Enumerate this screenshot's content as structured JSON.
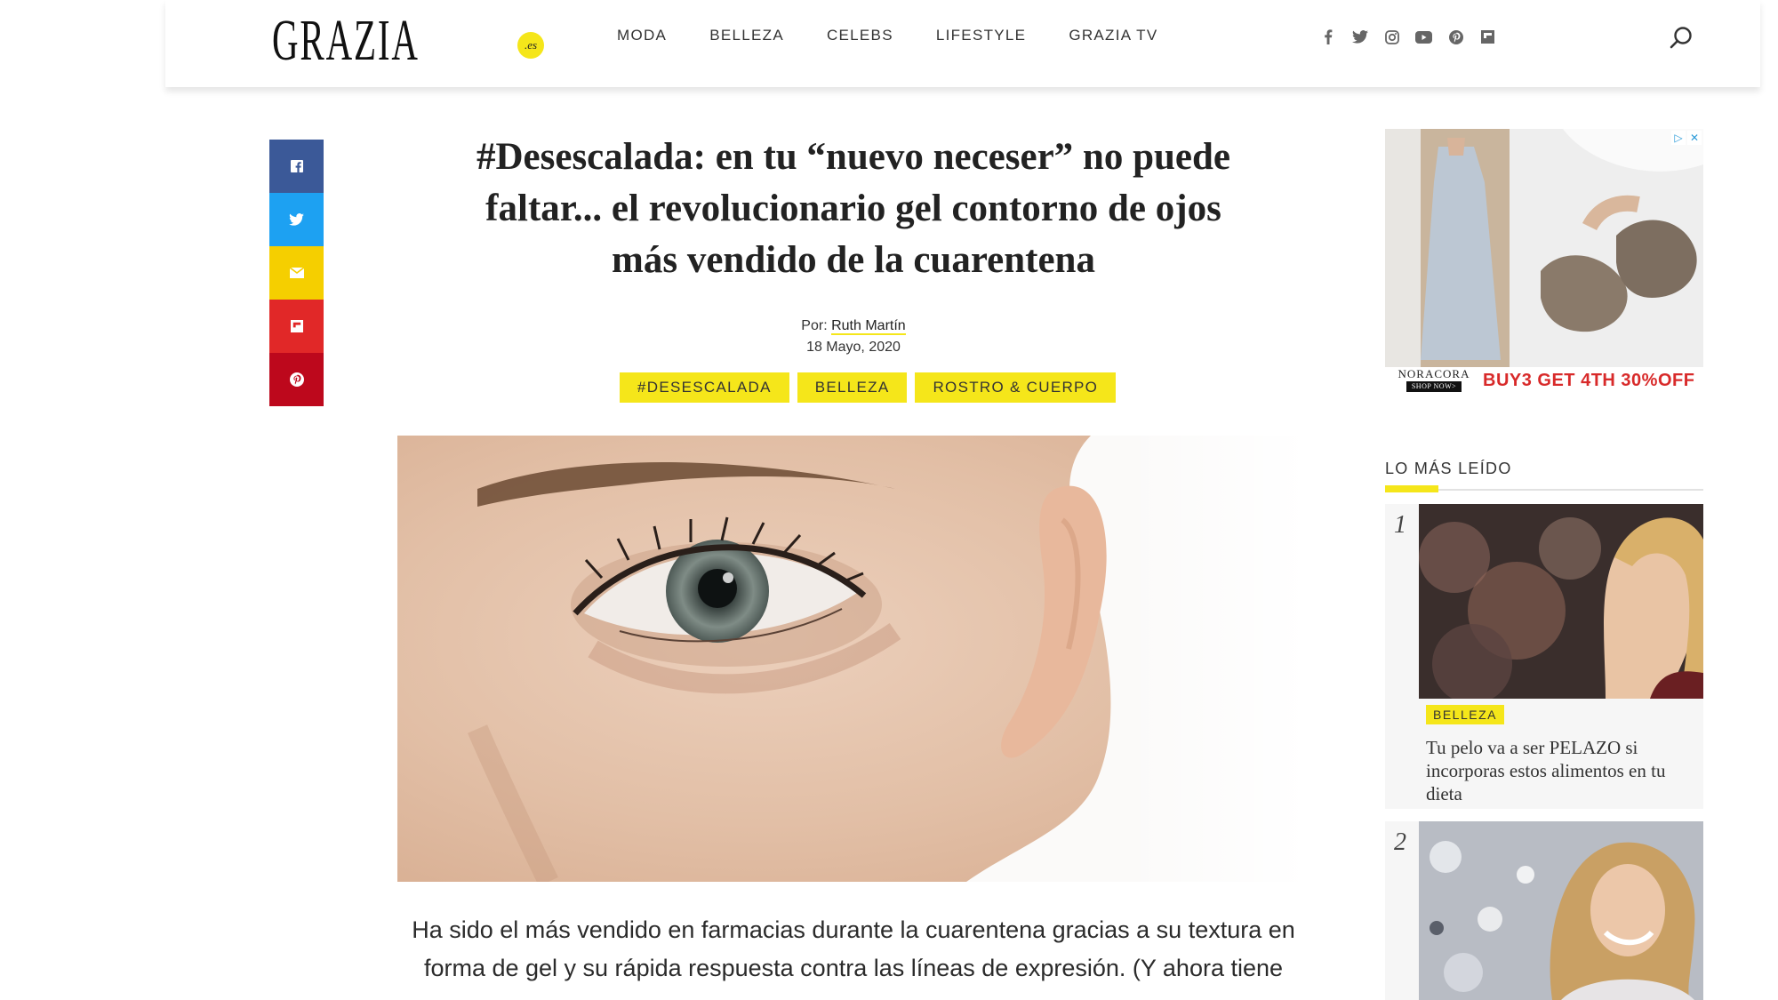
{
  "brand": {
    "logo": "GRAZIA",
    "logo_suffix": ".es",
    "accent_color": "#f5e61a"
  },
  "nav": {
    "items": [
      "MODA",
      "BELLEZA",
      "CELEBS",
      "LIFESTYLE",
      "GRAZIA TV"
    ]
  },
  "social_icons": [
    "facebook-icon",
    "twitter-icon",
    "instagram-icon",
    "youtube-icon",
    "pinterest-icon",
    "flipboard-icon"
  ],
  "share_bar": [
    {
      "icon": "facebook-icon",
      "color": "#3b5998"
    },
    {
      "icon": "twitter-icon",
      "color": "#1da1f2"
    },
    {
      "icon": "email-icon",
      "color": "#f5cf00"
    },
    {
      "icon": "flipboard-icon",
      "color": "#e12828"
    },
    {
      "icon": "pinterest-icon",
      "color": "#bd081c"
    }
  ],
  "article": {
    "title": "#Desescalada: en tu “nuevo neceser” no puede faltar... el revolucionario gel contorno de ojos más vendido de la cuarentena",
    "by_label": "Por:",
    "author": "Ruth Martín",
    "date": "18 Mayo, 2020",
    "tags": [
      "#DESESCALADA",
      "BELLEZA",
      "ROSTRO & CUERPO"
    ],
    "lede": "Ha sido el más vendido en farmacias durante la cuarentena gracias a su textura en forma de gel y su rápida respuesta contra las líneas de expresión. (Y ahora tiene"
  },
  "ad": {
    "brand": "NORACORA",
    "shop_now": "SHOP NOW>",
    "offer": "BUY3 GET 4TH 30%OFF"
  },
  "popular": {
    "title": "LO MÁS LEÍDO",
    "items": [
      {
        "rank": "1",
        "category": "BELLEZA",
        "title": "Tu pelo va a ser PELAZO si incorporas estos alimentos en tu dieta"
      },
      {
        "rank": "2"
      }
    ]
  }
}
